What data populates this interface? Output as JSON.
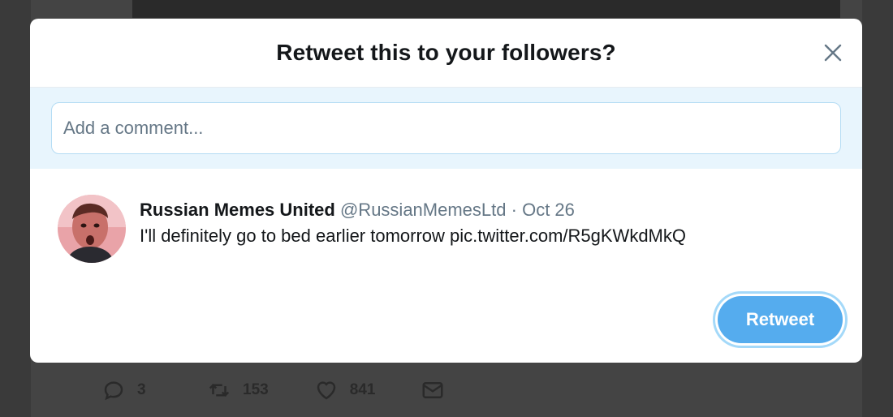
{
  "dialog": {
    "title": "Retweet this to your followers?",
    "close_icon": "close-icon",
    "comment_placeholder": "Add a comment...",
    "retweet_label": "Retweet"
  },
  "quoted_tweet": {
    "author": "Russian Memes United",
    "handle": "@RussianMemesLtd",
    "separator": "·",
    "date": "Oct 26",
    "text": "I'll definitely go to bed earlier tomorrow pic.twitter.com/R5gKWkdMkQ"
  },
  "background_tweet_actions": {
    "replies": "3",
    "retweets": "153",
    "likes": "841"
  },
  "colors": {
    "accent": "#55acee",
    "comment_band": "#e8f5fd",
    "secondary_text": "#657786",
    "primary_text": "#14171a"
  }
}
